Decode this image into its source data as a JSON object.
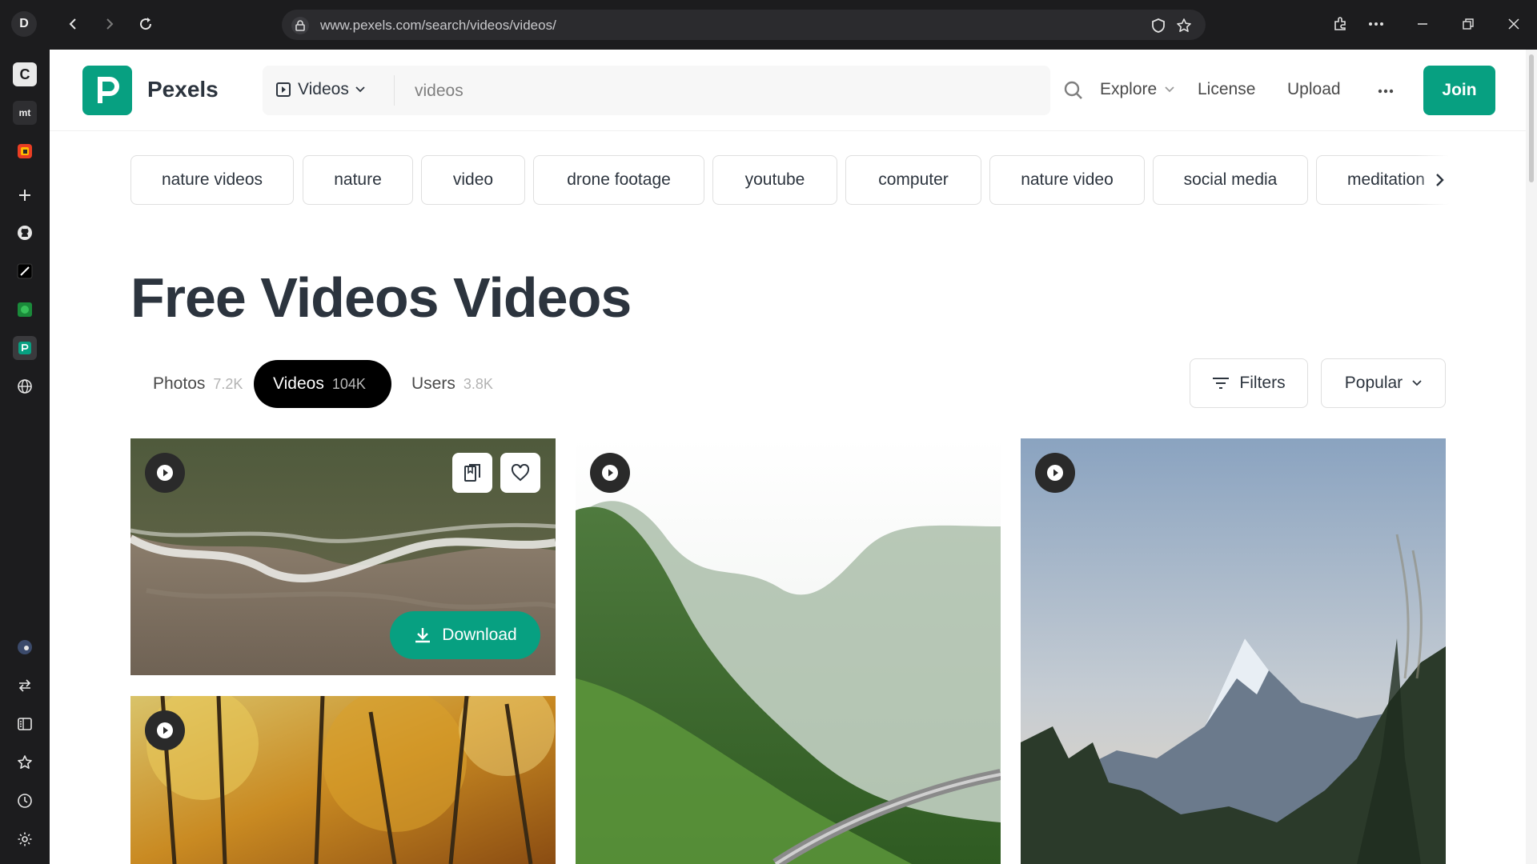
{
  "browser": {
    "profile_initial": "D",
    "url": "www.pexels.com/search/videos/videos/"
  },
  "sidebar": {
    "items": [
      "c-app-icon",
      "mt-app-icon",
      "office-app-icon",
      "add-icon",
      "github-icon",
      "notes-app-icon",
      "green-app-icon",
      "pexels-app-icon",
      "globe-icon",
      "circle-app-icon",
      "transfer-icon",
      "sidebar-panel-icon",
      "favorites-star-icon",
      "history-clock-icon",
      "settings-gear-icon"
    ],
    "labels": {
      "c": "C",
      "mt": "mt"
    }
  },
  "header": {
    "logo_text": "Pexels",
    "search_type": "Videos",
    "search_query": "videos",
    "nav": {
      "explore": "Explore",
      "license": "License",
      "upload": "Upload"
    },
    "join": "Join"
  },
  "chips": [
    "nature videos",
    "nature",
    "video",
    "drone footage",
    "youtube",
    "computer",
    "nature video",
    "social media",
    "meditation"
  ],
  "page_title": "Free Videos Videos",
  "tabs": [
    {
      "label": "Photos",
      "count": "7.2K"
    },
    {
      "label": "Videos",
      "count": "104K"
    },
    {
      "label": "Users",
      "count": "3.8K"
    }
  ],
  "controls": {
    "filters": "Filters",
    "sort": "Popular"
  },
  "cards": {
    "download_label": "Download"
  },
  "colors": {
    "brand": "#07a081",
    "text": "#2c343e",
    "chrome": "#1c1c1e"
  }
}
